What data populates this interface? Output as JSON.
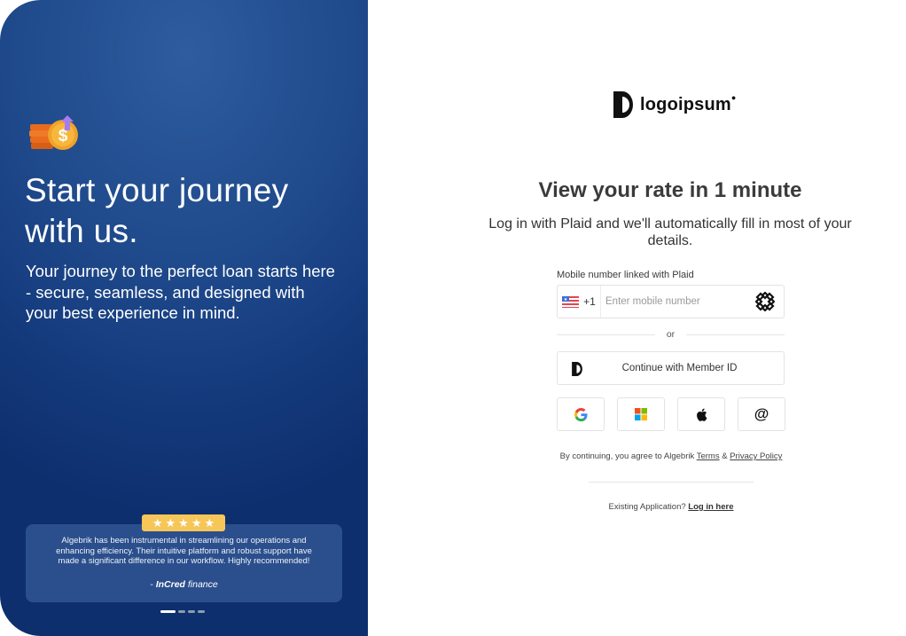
{
  "hero": {
    "icon": "coin-growth-icon",
    "title": "Start your journey with us.",
    "subtitle": "Your journey to the perfect loan starts here - secure, seamless, and designed with your best experience in mind."
  },
  "testimonial": {
    "rating": 5,
    "rating_max": 5,
    "stars": "★★★★★",
    "text": "Algebrik has been instrumental in streamlining our operations and enhancing efficiency. Their intuitive platform and robust support have made a significant difference in our workflow. Highly recommended!",
    "author_prefix": "- ",
    "author_bold": "InCred",
    "author_rest": " finance",
    "carousel_total": 4,
    "carousel_active": 1
  },
  "brand": {
    "logo_text": "logoipsum",
    "logo_mark": "®",
    "accent": "#1f4a8c",
    "star_color": "#f6c659"
  },
  "form": {
    "title": "View your rate in 1 minute",
    "subtitle": "Log in with Plaid and we'll automatically fill in most of your details.",
    "phone_label": "Mobile number linked with Plaid",
    "country_code": "+1",
    "country_flag": "us-flag-icon",
    "phone_value": "",
    "phone_placeholder": "Enter mobile number",
    "or_label": "or",
    "member_button": "Continue with Member ID",
    "social": [
      "google",
      "microsoft",
      "apple",
      "email"
    ],
    "terms_prefix": "By continuing, you agree to Algebrik ",
    "terms_link": "Terms",
    "terms_amp": " & ",
    "privacy_link": "Privacy Policy",
    "existing_prefix": "Existing Application? ",
    "login_link": "Log in here"
  }
}
